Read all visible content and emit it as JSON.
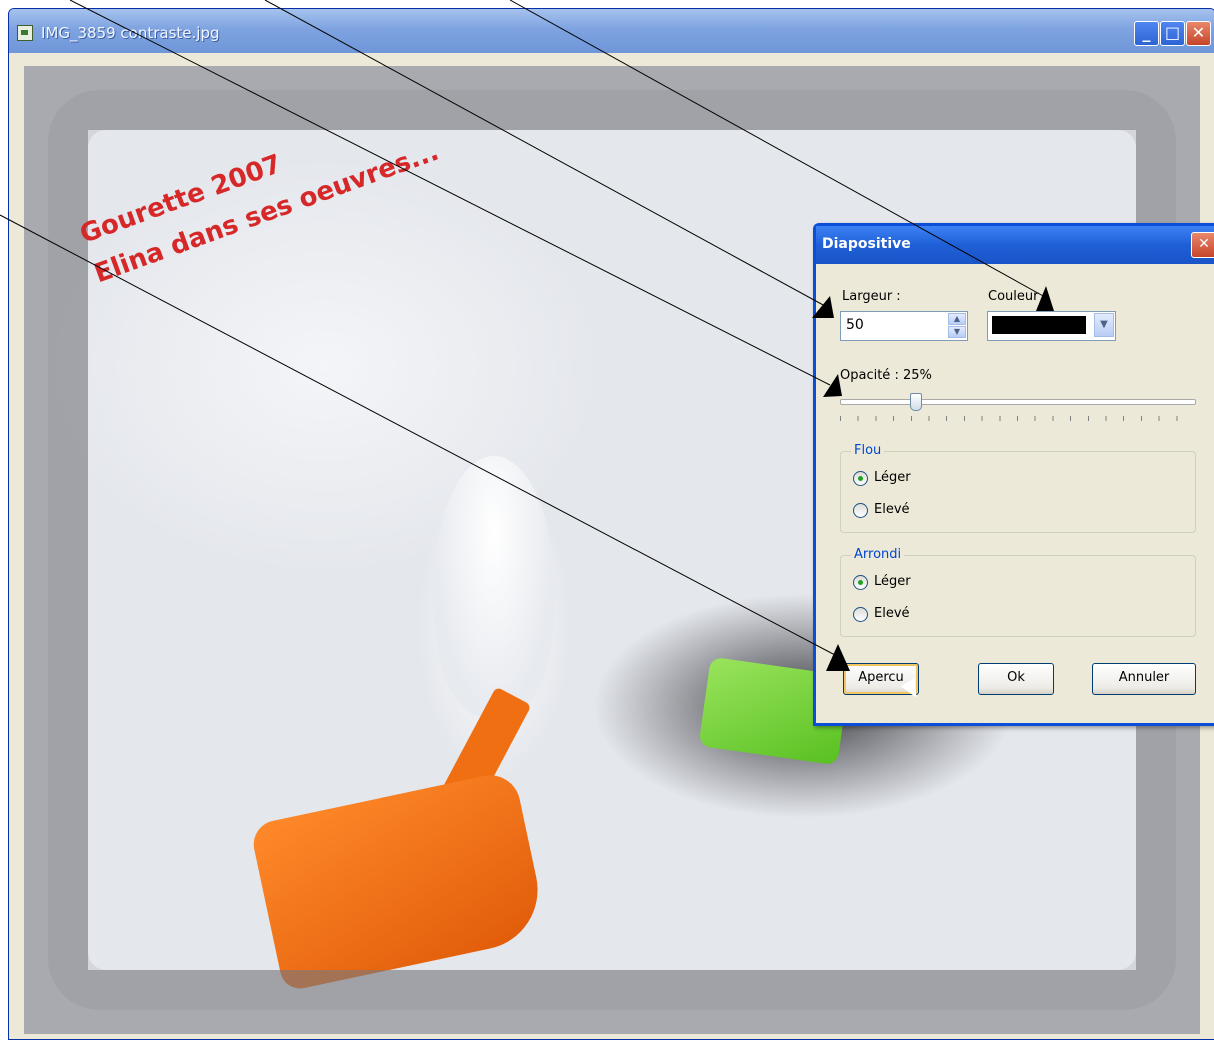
{
  "window": {
    "title": "IMG_3859 contraste.jpg",
    "buttons": {
      "minimize": "_",
      "maximize": "□",
      "close": "✕"
    }
  },
  "photo": {
    "caption_line1": "Gourette 2007",
    "caption_line2": "Elina dans ses oeuvres..."
  },
  "dialog": {
    "title": "Diapositive",
    "close": "✕",
    "largeur_label": "Largeur :",
    "largeur_value": "50",
    "couleur_label": "Couleur",
    "couleur_value": "#000000",
    "opacite_label": "Opacité : 25%",
    "opacite_value": 25,
    "flou_title": "Flou",
    "flou_options": [
      "Léger",
      "Elevé"
    ],
    "flou_selected": "Léger",
    "arrondi_title": "Arrondi",
    "arrondi_options": [
      "Léger",
      "Elevé"
    ],
    "arrondi_selected": "Léger",
    "btn_apercu": "Apercu",
    "btn_ok": "Ok",
    "btn_annuler": "Annuler"
  }
}
